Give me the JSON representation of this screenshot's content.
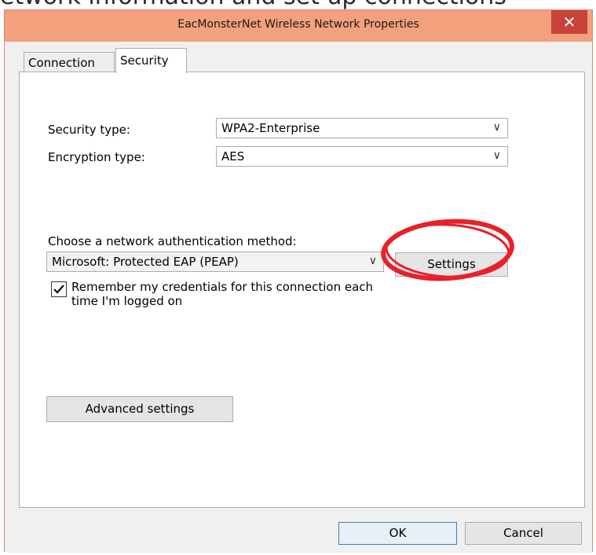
{
  "background_text": "etwork information and set up connections",
  "window": {
    "title": "EacMonsterNet Wireless Network Properties",
    "close_label": "✕"
  },
  "tabs": [
    {
      "label": "Connection",
      "active": false
    },
    {
      "label": "Security",
      "active": true
    }
  ],
  "security": {
    "security_type_label": "Security type:",
    "security_type_value": "WPA2-Enterprise",
    "encryption_type_label": "Encryption type:",
    "encryption_type_value": "AES",
    "auth_method_label": "Choose a network authentication method:",
    "auth_method_value": "Microsoft: Protected EAP (PEAP)",
    "settings_button": "Settings",
    "remember_label_line1": "Remember my credentials for this connection each",
    "remember_label_line2": "time I'm logged on",
    "remember_checked": true,
    "advanced_button": "Advanced settings"
  },
  "footer": {
    "ok_button": "OK",
    "cancel_button": "Cancel"
  },
  "colors": {
    "titlebar": "#f3a07d",
    "close": "#c7433a",
    "annotation": "#e8202a"
  }
}
